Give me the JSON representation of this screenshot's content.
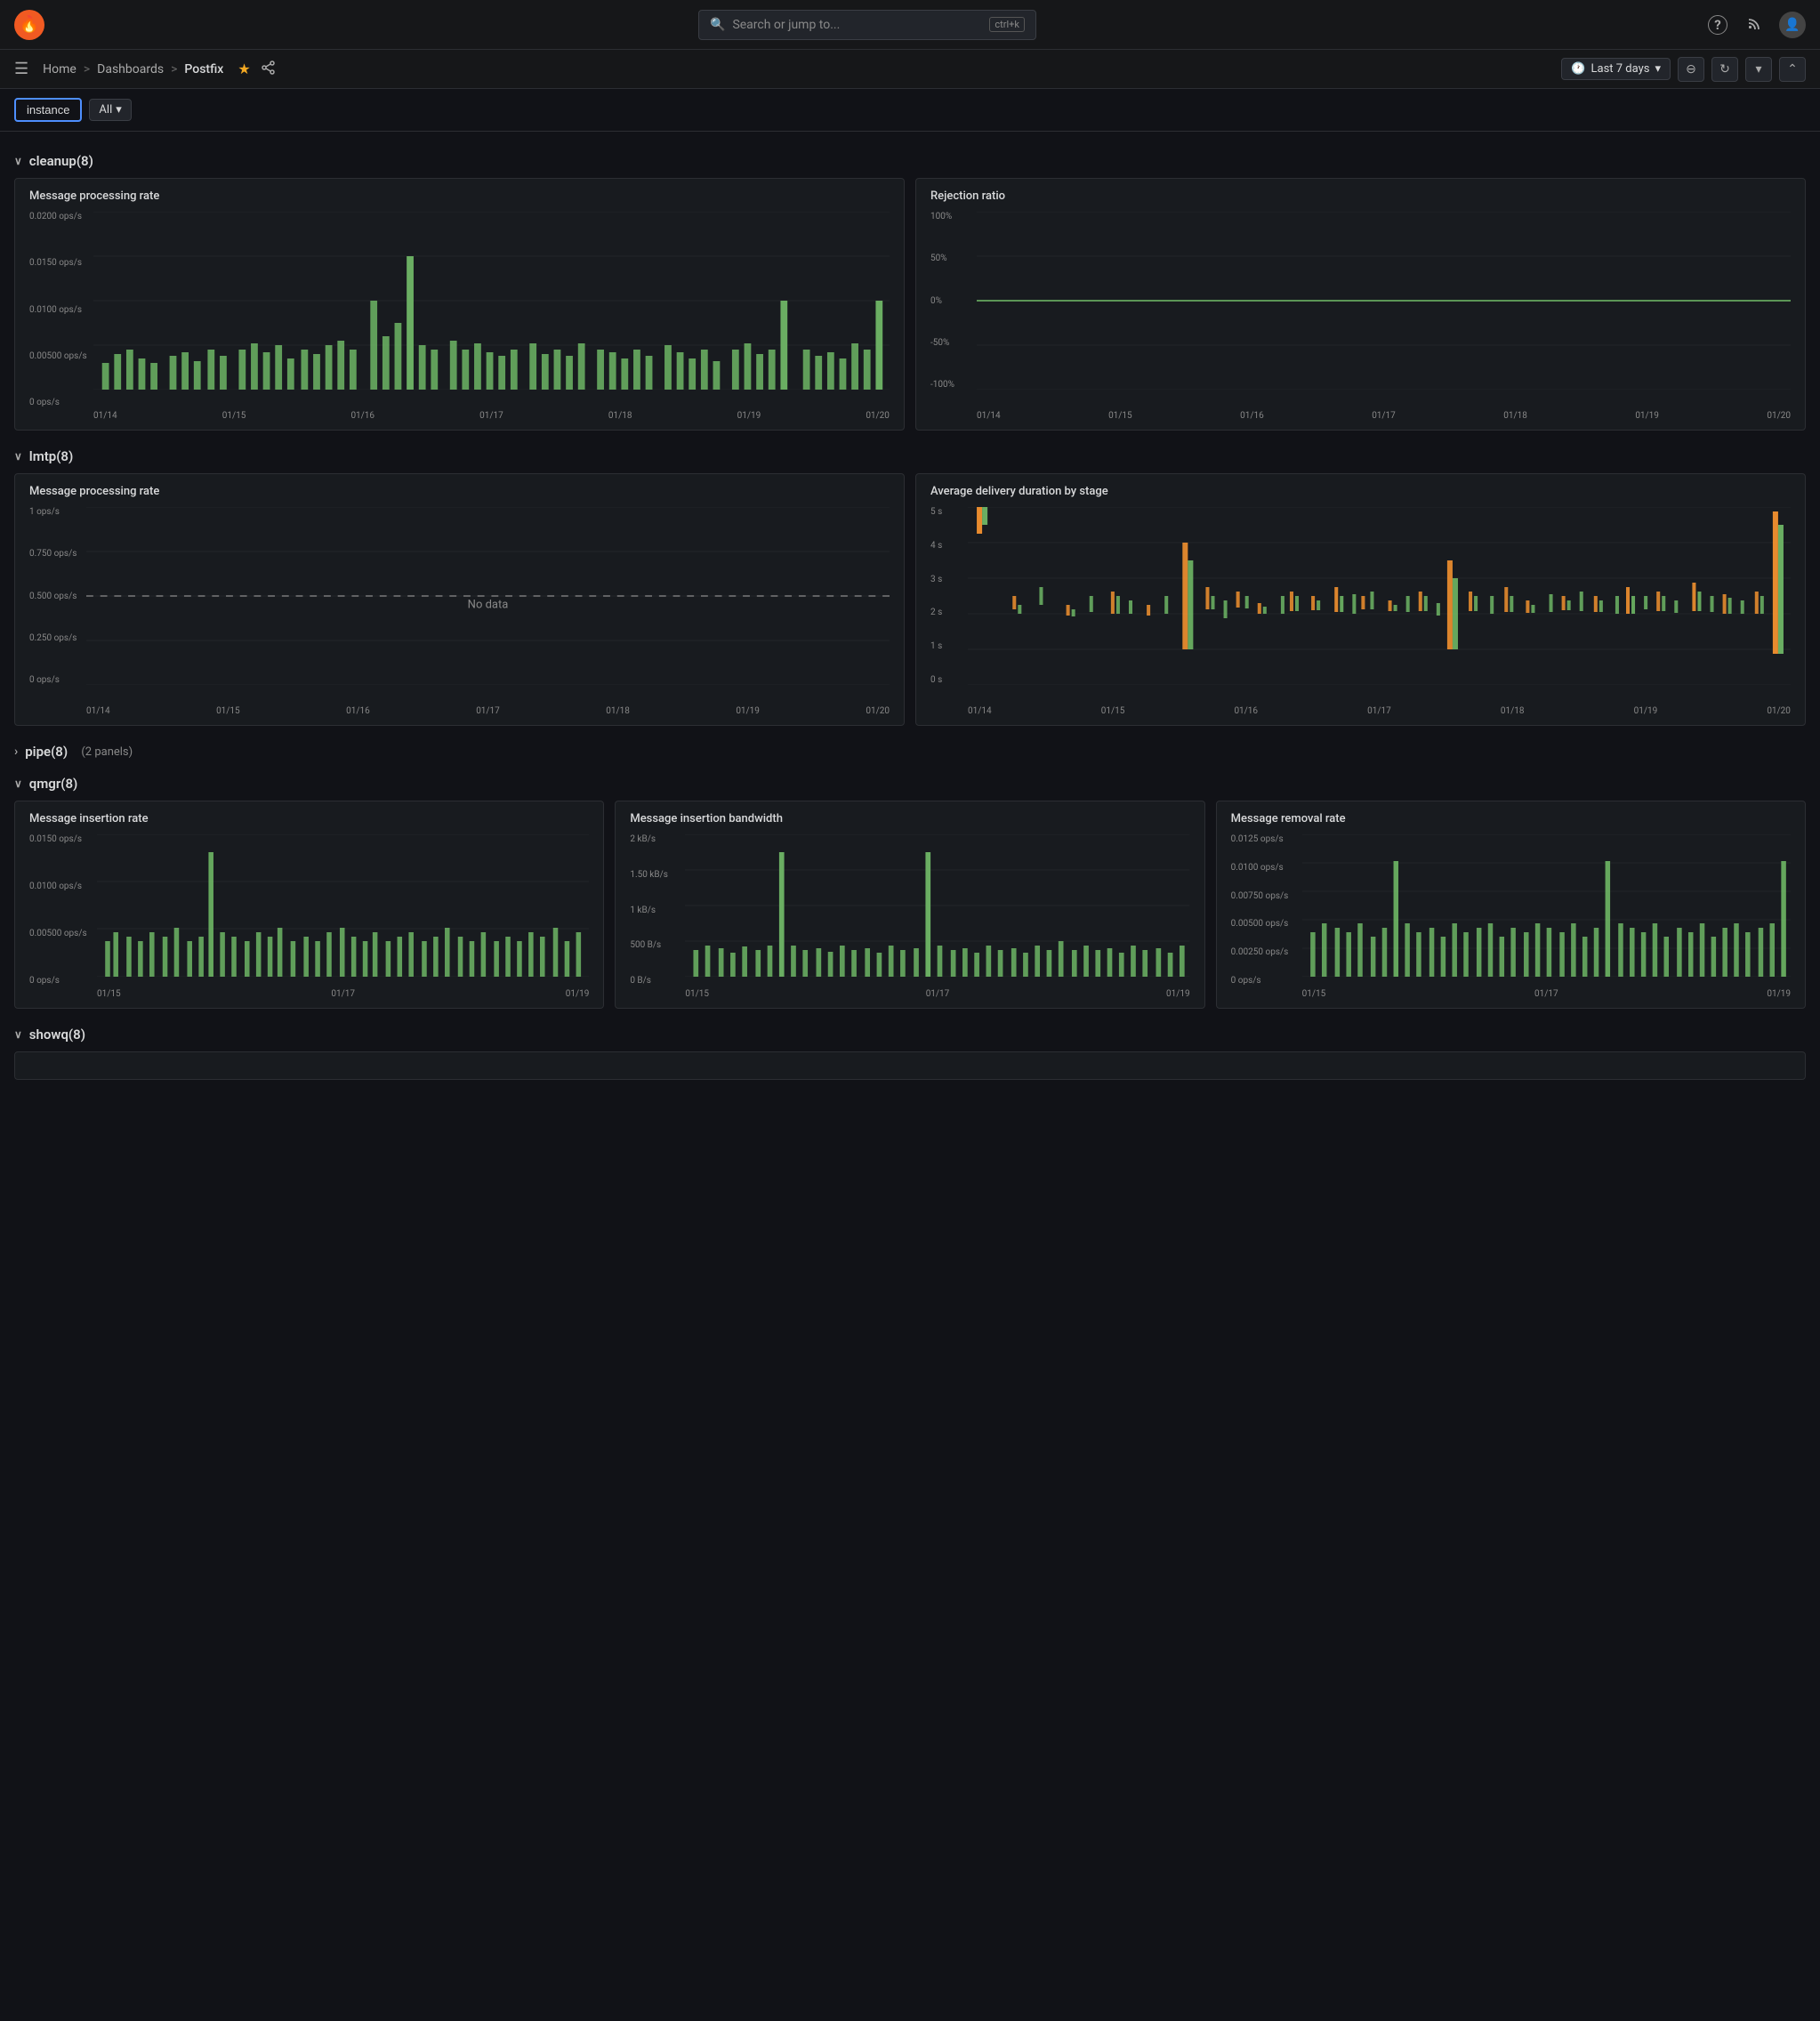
{
  "topnav": {
    "logo": "🔥",
    "search_placeholder": "Search or jump to...",
    "search_kbd": "ctrl+k",
    "help_icon": "?",
    "news_icon": "📡",
    "avatar_icon": "👤"
  },
  "breadcrumb": {
    "menu_icon": "☰",
    "home": "Home",
    "sep1": ">",
    "dashboards": "Dashboards",
    "sep2": ">",
    "current": "Postfix",
    "star": "★",
    "share": "⋮",
    "time_range": "Last 7 days",
    "zoom_out": "⊖",
    "refresh": "↻",
    "more": "⌄",
    "collapse": "⌃"
  },
  "filters": {
    "instance_label": "instance",
    "all_label": "All",
    "all_chevron": "▾"
  },
  "sections": [
    {
      "id": "cleanup",
      "chevron": "∨",
      "label": "cleanup(8)",
      "note": ""
    },
    {
      "id": "lmtp",
      "chevron": "∨",
      "label": "lmtp(8)",
      "note": ""
    },
    {
      "id": "pipe",
      "chevron": "›",
      "label": "pipe(8)",
      "note": "(2 panels)"
    },
    {
      "id": "qmgr",
      "chevron": "∨",
      "label": "qmgr(8)",
      "note": ""
    },
    {
      "id": "showq",
      "chevron": "∨",
      "label": "showq(8)",
      "note": ""
    }
  ],
  "cleanup_charts": [
    {
      "id": "msg-processing-rate",
      "title": "Message processing rate",
      "yLabels": [
        "0.0200 ops/s",
        "0.0150 ops/s",
        "0.0100 ops/s",
        "0.00500 ops/s",
        "0 ops/s"
      ],
      "xLabels": [
        "01/14",
        "01/15",
        "01/16",
        "01/17",
        "01/18",
        "01/19",
        "01/20"
      ],
      "hasData": true,
      "type": "bar-green"
    },
    {
      "id": "rejection-ratio",
      "title": "Rejection ratio",
      "yLabels": [
        "100%",
        "50%",
        "0%",
        "-50%",
        "-100%"
      ],
      "xLabels": [
        "01/14",
        "01/15",
        "01/16",
        "01/17",
        "01/18",
        "01/19",
        "01/20"
      ],
      "hasData": true,
      "type": "line-green-flat"
    }
  ],
  "lmtp_charts": [
    {
      "id": "lmtp-msg-rate",
      "title": "Message processing rate",
      "yLabels": [
        "1 ops/s",
        "0.750 ops/s",
        "0.500 ops/s",
        "0.250 ops/s",
        "0 ops/s"
      ],
      "xLabels": [
        "01/14",
        "01/15",
        "01/16",
        "01/17",
        "01/18",
        "01/19",
        "01/20"
      ],
      "hasData": false,
      "noDataText": "No data"
    },
    {
      "id": "avg-delivery",
      "title": "Average delivery duration by stage",
      "yLabels": [
        "5 s",
        "4 s",
        "3 s",
        "2 s",
        "1 s",
        "0 s"
      ],
      "xLabels": [
        "01/14",
        "01/15",
        "01/16",
        "01/17",
        "01/18",
        "01/19",
        "01/20"
      ],
      "hasData": true,
      "type": "bar-orange-green"
    }
  ],
  "qmgr_charts": [
    {
      "id": "msg-insertion-rate",
      "title": "Message insertion rate",
      "yLabels": [
        "0.0150 ops/s",
        "0.0100 ops/s",
        "0.00500 ops/s",
        "0 ops/s"
      ],
      "xLabels": [
        "01/15",
        "01/17",
        "01/19"
      ],
      "hasData": true,
      "type": "bar-green-small"
    },
    {
      "id": "msg-insertion-bw",
      "title": "Message insertion bandwidth",
      "yLabels": [
        "2 kB/s",
        "1.50 kB/s",
        "1 kB/s",
        "500 B/s",
        "0 B/s"
      ],
      "xLabels": [
        "01/15",
        "01/17",
        "01/19"
      ],
      "hasData": true,
      "type": "bar-green-small"
    },
    {
      "id": "msg-removal-rate",
      "title": "Message removal rate",
      "yLabels": [
        "0.0125 ops/s",
        "0.0100 ops/s",
        "0.00750 ops/s",
        "0.00500 ops/s",
        "0.00250 ops/s",
        "0 ops/s"
      ],
      "xLabels": [
        "01/15",
        "01/17",
        "01/19"
      ],
      "hasData": true,
      "type": "bar-green-small"
    }
  ],
  "colors": {
    "background": "#111217",
    "card_bg": "#181b1f",
    "border": "#2c2e33",
    "green_bar": "#73bf69",
    "orange_bar": "#ff9830",
    "line_green": "#73bf69",
    "accent_blue": "#4e8fff",
    "text_primary": "#d8d9da",
    "text_muted": "#888888"
  }
}
